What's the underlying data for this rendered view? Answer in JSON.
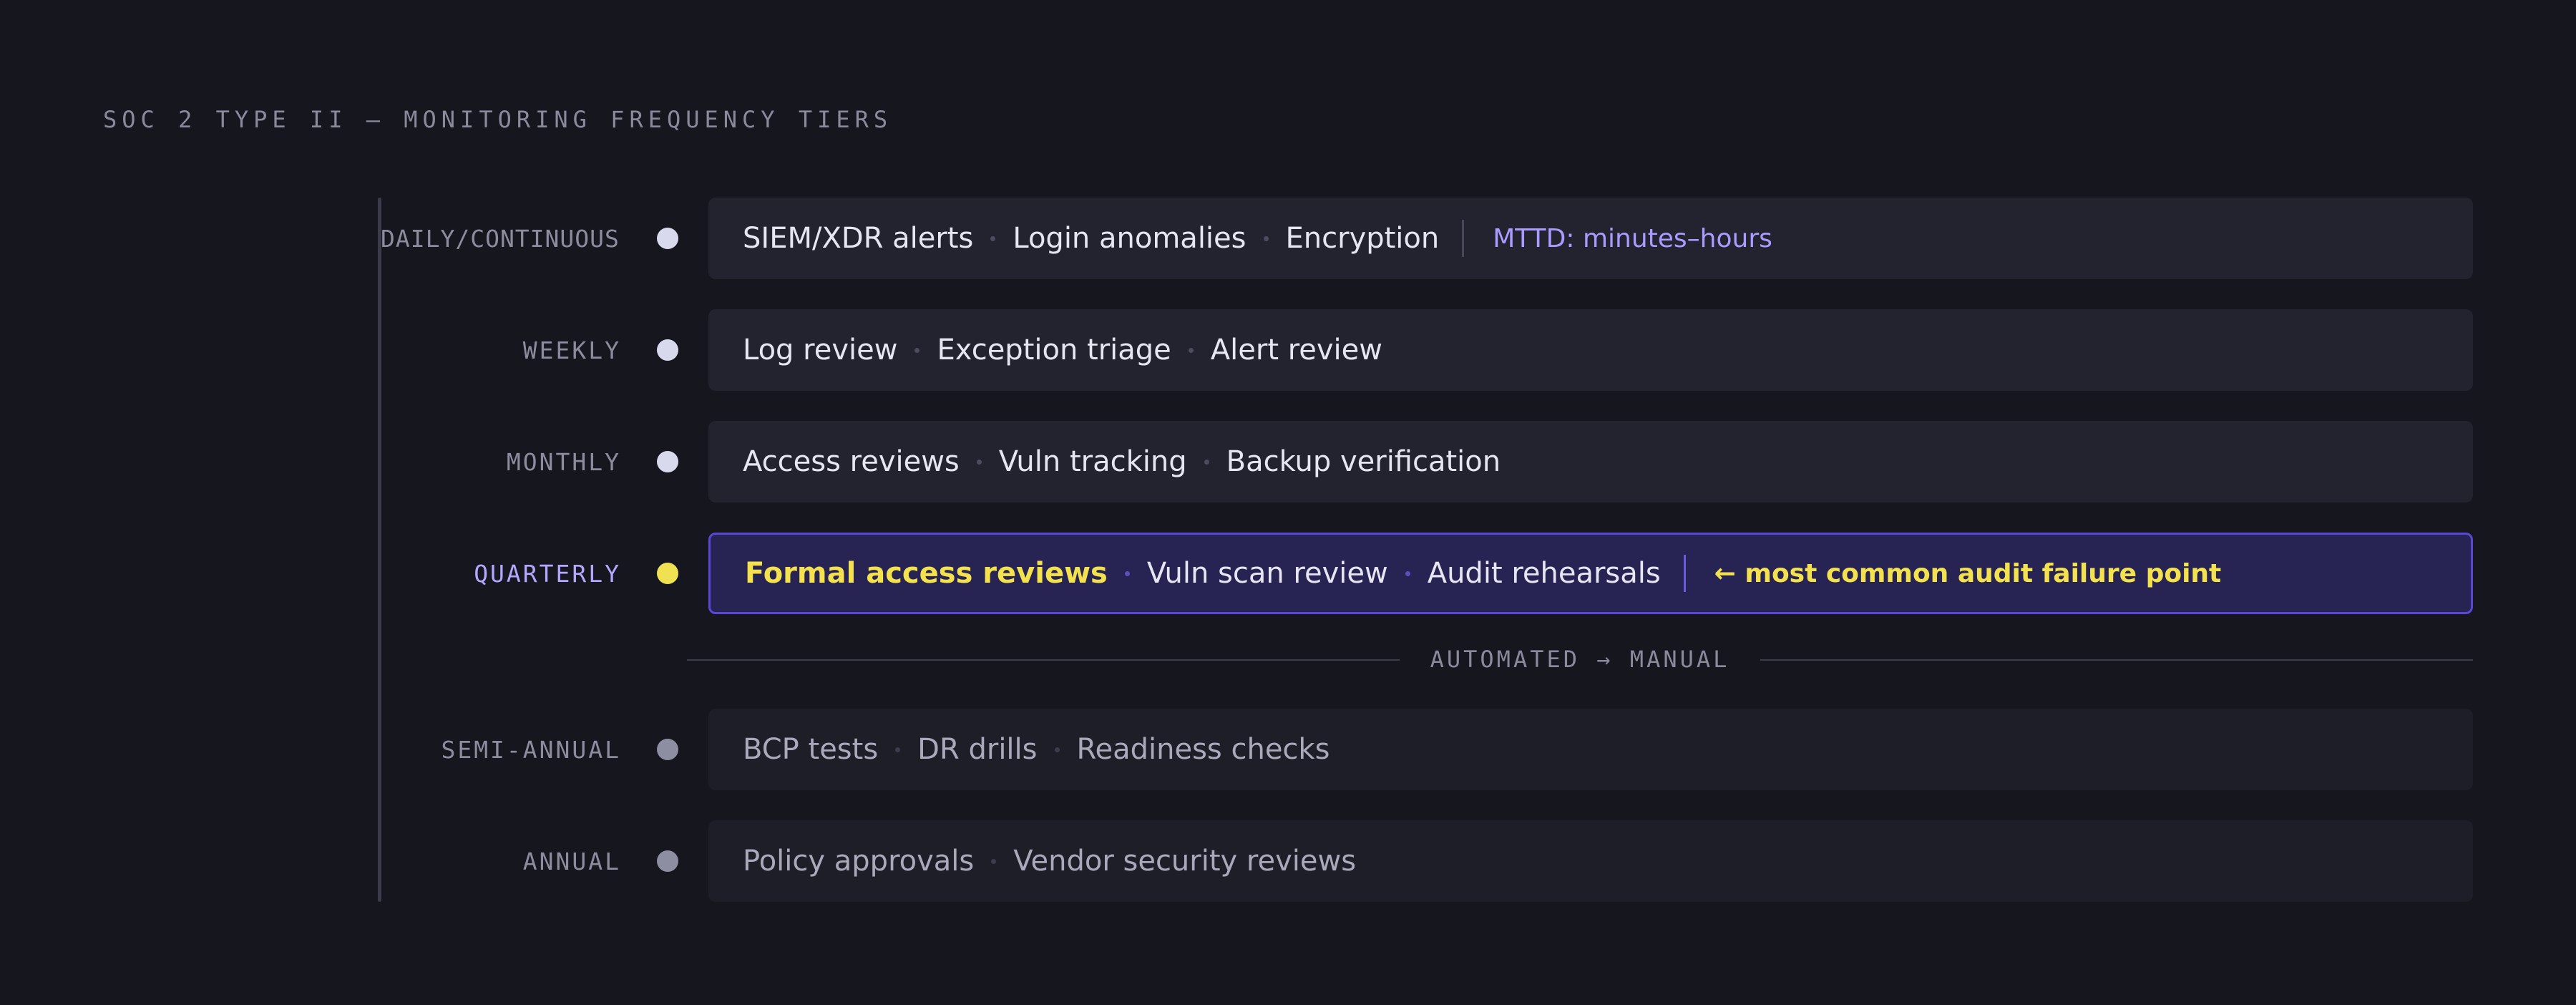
{
  "title": "SOC 2 TYPE II — MONITORING FREQUENCY TIERS",
  "tiers": [
    {
      "label": "DAILY/CONTINUOUS",
      "items": [
        "SIEM/XDR alerts",
        "Login anomalies",
        "Encryption"
      ],
      "note": "MTTD: minutes–hours"
    },
    {
      "label": "WEEKLY",
      "items": [
        "Log review",
        "Exception triage",
        "Alert review"
      ]
    },
    {
      "label": "MONTHLY",
      "items": [
        "Access reviews",
        "Vuln tracking",
        "Backup verification"
      ]
    },
    {
      "label": "QUARTERLY",
      "items": [
        "Formal access reviews",
        "Vuln scan review",
        "Audit rehearsals"
      ],
      "note": "← most common audit failure point"
    },
    {
      "label": "SEMI-ANNUAL",
      "items": [
        "BCP tests",
        "DR drills",
        "Readiness checks"
      ]
    },
    {
      "label": "ANNUAL",
      "items": [
        "Policy approvals",
        "Vendor security reviews"
      ]
    }
  ],
  "divider": "AUTOMATED → MANUAL",
  "colors": {
    "background": "#16161f",
    "highlight": "#f3e24e",
    "accent": "#5a47d6",
    "note": "#a99bff"
  }
}
